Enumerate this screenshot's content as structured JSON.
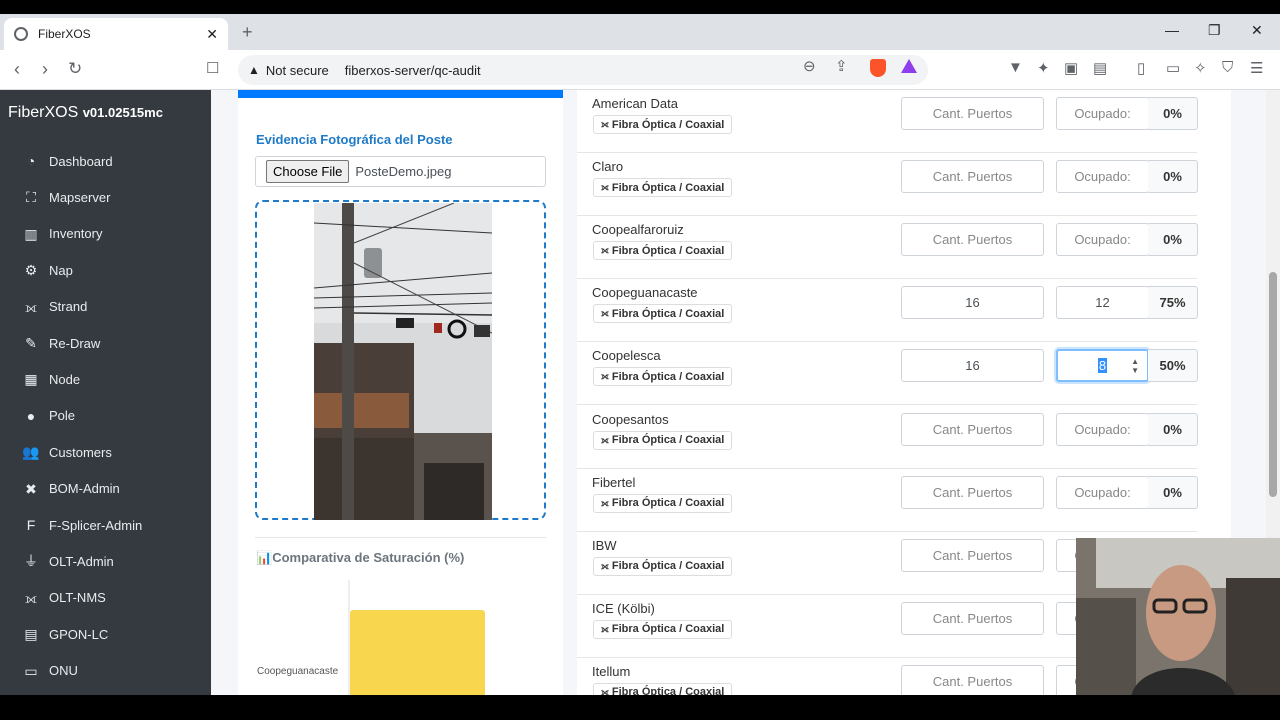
{
  "browser": {
    "tab_title": "FiberXOS",
    "new_tab": "+",
    "security_label": "Not secure",
    "url": "fiberxos-server/qc-audit"
  },
  "sidebar": {
    "brand": "FiberXOS",
    "version": "v01.02515mc",
    "items": [
      {
        "label": "Dashboard",
        "icon": "dashboard-icon"
      },
      {
        "label": "Mapserver",
        "icon": "map-icon"
      },
      {
        "label": "Inventory",
        "icon": "inventory-icon"
      },
      {
        "label": "Nap",
        "icon": "nap-icon"
      },
      {
        "label": "Strand",
        "icon": "strand-icon"
      },
      {
        "label": "Re-Draw",
        "icon": "pencil-icon"
      },
      {
        "label": "Node",
        "icon": "node-icon"
      },
      {
        "label": "Pole",
        "icon": "pole-icon"
      },
      {
        "label": "Customers",
        "icon": "users-icon"
      },
      {
        "label": "BOM-Admin",
        "icon": "tools-icon"
      },
      {
        "label": "F-Splicer-Admin",
        "icon": "splicer-icon"
      },
      {
        "label": "OLT-Admin",
        "icon": "plug-icon"
      },
      {
        "label": "OLT-NMS",
        "icon": "network-icon"
      },
      {
        "label": "GPON-LC",
        "icon": "hdd-icon"
      },
      {
        "label": "ONU",
        "icon": "monitor-icon"
      }
    ]
  },
  "evidence": {
    "title": "Evidencia Fotográfica del Poste",
    "file_button": "Choose File",
    "file_name": "PosteDemo.jpeg"
  },
  "chart_data": {
    "type": "bar",
    "title": "Comparativa de Saturación (%)",
    "orientation": "horizontal",
    "categories": [
      "Coopeguanacaste"
    ],
    "values": [
      75
    ],
    "xlim": [
      0,
      100
    ],
    "color": "#f8d64e"
  },
  "operators": {
    "placeholder_puertos": "Cant. Puertos",
    "placeholder_ocupado": "Ocupado:",
    "rows": [
      {
        "name": "American Data",
        "type": "Fibra Óptica / Coaxial",
        "puertos": "",
        "ocupado": "",
        "pct": "0%"
      },
      {
        "name": "Claro",
        "type": "Fibra Óptica / Coaxial",
        "puertos": "",
        "ocupado": "",
        "pct": "0%"
      },
      {
        "name": "Coopealfaroruiz",
        "type": "Fibra Óptica / Coaxial",
        "puertos": "",
        "ocupado": "",
        "pct": "0%"
      },
      {
        "name": "Coopeguanacaste",
        "type": "Fibra Óptica / Coaxial",
        "puertos": "16",
        "ocupado": "12",
        "pct": "75%"
      },
      {
        "name": "Coopelesca",
        "type": "Fibra Óptica / Coaxial",
        "puertos": "16",
        "ocupado": "8",
        "pct": "50%"
      },
      {
        "name": "Coopesantos",
        "type": "Fibra Óptica / Coaxial",
        "puertos": "",
        "ocupado": "",
        "pct": "0%"
      },
      {
        "name": "Fibertel",
        "type": "Fibra Óptica / Coaxial",
        "puertos": "",
        "ocupado": "",
        "pct": "0%"
      },
      {
        "name": "IBW",
        "type": "Fibra Óptica / Coaxial",
        "puertos": "",
        "ocupado": "",
        "pct": ""
      },
      {
        "name": "ICE (Kölbi)",
        "type": "Fibra Óptica / Coaxial",
        "puertos": "",
        "ocupado": "",
        "pct": ""
      },
      {
        "name": "Itellum",
        "type": "Fibra Óptica / Coaxial",
        "puertos": "",
        "ocupado": "",
        "pct": ""
      }
    ]
  }
}
